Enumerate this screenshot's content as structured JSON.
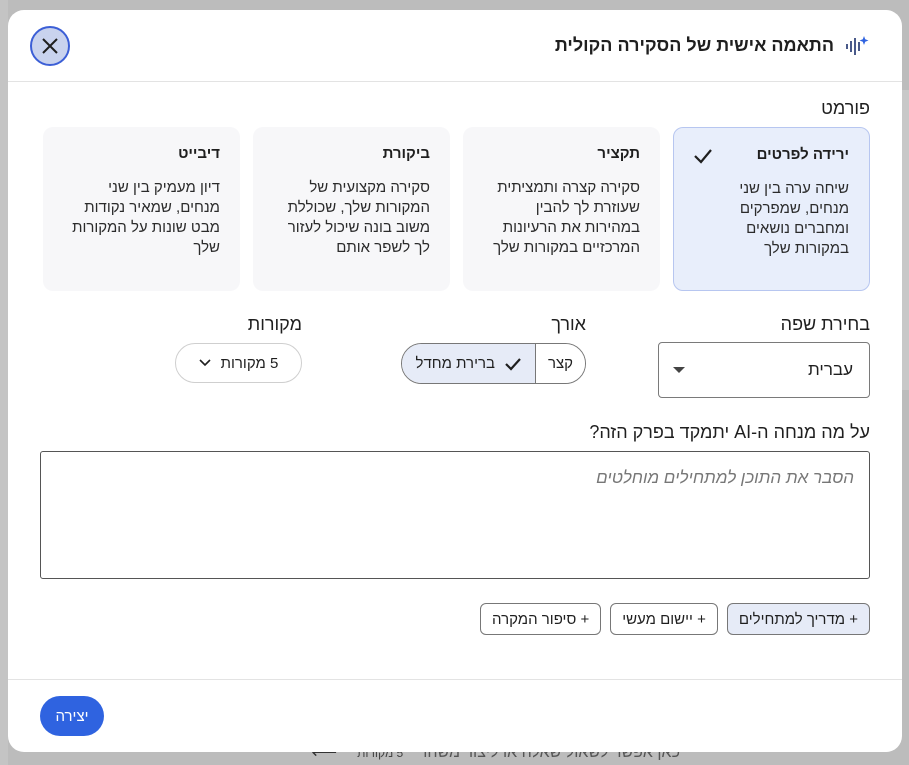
{
  "background": {
    "sources_count": "5 מקורות",
    "input_placeholder": "כאן אפשר לשאול שאלה או ליצור משהו"
  },
  "modal": {
    "title": "התאמה אישית של הסקירה הקולית",
    "format_label": "פורמט",
    "formats": [
      {
        "title": "ירידה לפרטים",
        "desc": "שיחה ערה בין שני מנחים, שמפרקים ומחברים נושאים במקורות שלך",
        "selected": true
      },
      {
        "title": "תקציר",
        "desc": "סקירה קצרה ותמציתית שעוזרת לך להבין במהירות את הרעיונות המרכזיים במקורות שלך",
        "selected": false
      },
      {
        "title": "ביקורת",
        "desc": "סקירה מקצועית של המקורות שלך, שכוללת משוב בונה שיכול לעזור לך לשפר אותם",
        "selected": false
      },
      {
        "title": "דיבייט",
        "desc": "דיון מעמיק בין שני מנחים, שמאיר נקודות מבט שונות על המקורות שלך",
        "selected": false
      }
    ],
    "language": {
      "label": "בחירת שפה",
      "value": "עברית"
    },
    "length": {
      "label": "אורך",
      "options": [
        "קצר",
        "ברירת מחדל"
      ],
      "selected": "ברירת מחדל"
    },
    "sources": {
      "label": "מקורות",
      "value": "5 מקורות"
    },
    "focus": {
      "label": "על מה מנחה ה-AI יתמקד בפרק הזה?",
      "placeholder": "הסבר את התוכן למתחילים מוחלטים",
      "value": ""
    },
    "chips": [
      {
        "label": "+ מדריך למתחילים",
        "active": true
      },
      {
        "label": "+ יישום מעשי",
        "active": false
      },
      {
        "label": "+ סיפור המקרה",
        "active": false
      }
    ],
    "create_label": "יצירה"
  },
  "colors": {
    "accent": "#2f63e0",
    "selected_card": "#e8eefb"
  }
}
